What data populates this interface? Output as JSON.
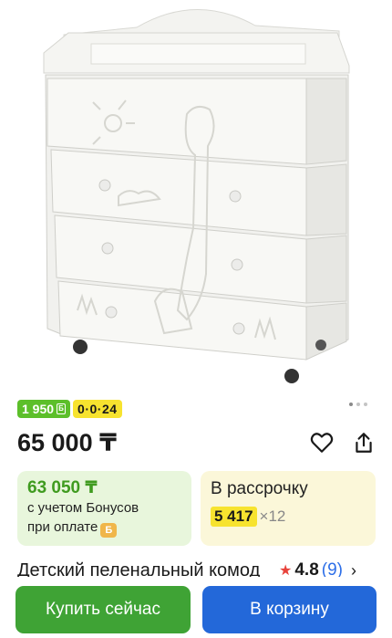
{
  "product": {
    "image_alt": "Детский пеленальный комод",
    "gallery_dots": 3,
    "bonus_badge": "1 950",
    "bonus_badge_icon": "Б",
    "installment_badge": "0·0·24",
    "price": "65 000 ₸",
    "title": "Детский пеленальный комод",
    "rating_value": "4.8",
    "rating_count": "(9)"
  },
  "bonus_card": {
    "amount": "63 050 ₸",
    "line1": "с учетом Бонусов",
    "line2": "при оплате",
    "coin_icon": "Б"
  },
  "installment_card": {
    "title": "В рассрочку",
    "amount": "5 417",
    "multiplier": "×12"
  },
  "buttons": {
    "buy_now": "Купить сейчас",
    "add_to_cart": "В корзину"
  },
  "icons": {
    "favorite": "heart-outline-icon",
    "share": "share-icon",
    "rating_star": "star-icon",
    "chevron": "chevron-right-icon"
  },
  "colors": {
    "bonus_green": "#5cbf2a",
    "installment_yellow": "#f7e32f",
    "buy_green": "#3fa335",
    "cart_blue": "#2368d9",
    "rating_red": "#e8423b",
    "link_blue": "#2d6fe8"
  }
}
